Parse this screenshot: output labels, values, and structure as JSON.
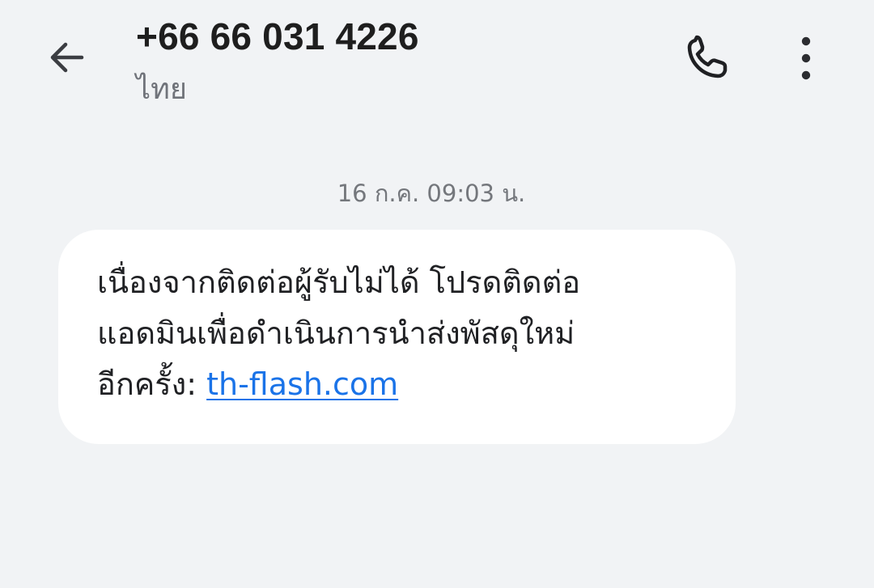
{
  "header": {
    "title": "+66 66 031 4226",
    "subtitle": "ไทย",
    "icons": {
      "back": "back-arrow-icon",
      "call": "phone-icon",
      "more": "more-vert-icon"
    }
  },
  "thread": {
    "date_label": "16 ก.ค. 09:03 น.",
    "message": {
      "line1": "เนื่องจากติดต่อผู้รับไม่ได้ โปรดติดต่อ",
      "line2": "แอดมินเพื่อดำเนินการนำส่งพัสดุใหม่",
      "line3_prefix": "อีกครั้ง: ",
      "link_text": "th-flash.com"
    }
  },
  "colors": {
    "background": "#f1f3f5",
    "bubble": "#ffffff",
    "link": "#1a73e8",
    "muted_text": "#74777c"
  }
}
